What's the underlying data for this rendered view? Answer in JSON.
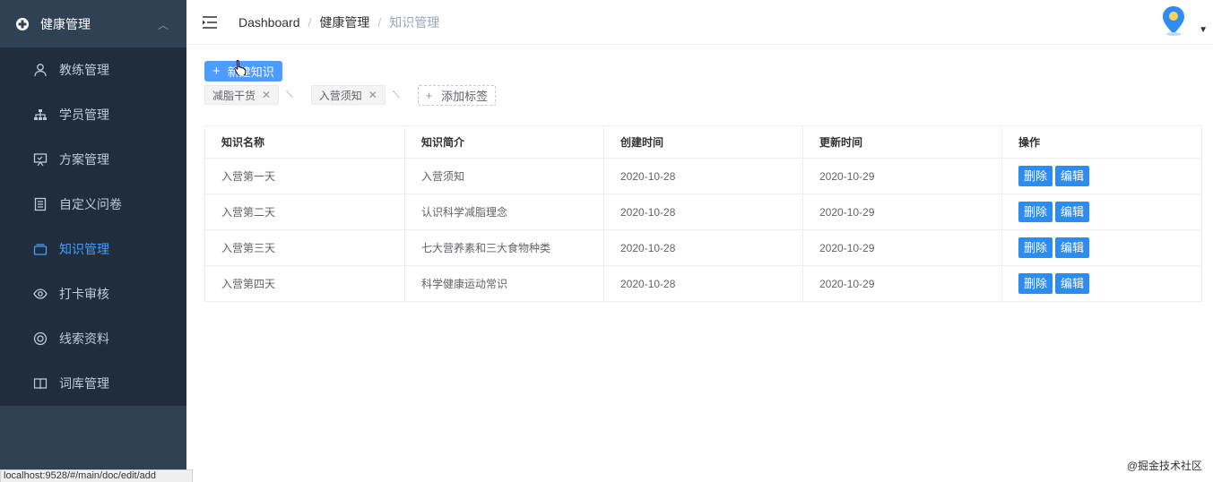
{
  "sidebar": {
    "parent_label": "健康管理",
    "items": [
      {
        "label": "教练管理",
        "icon": "user-icon"
      },
      {
        "label": "学员管理",
        "icon": "tree-icon"
      },
      {
        "label": "方案管理",
        "icon": "board-icon"
      },
      {
        "label": "自定义问卷",
        "icon": "form-icon"
      },
      {
        "label": "知识管理",
        "icon": "tray-icon",
        "active": true
      },
      {
        "label": "打卡审核",
        "icon": "eye-icon"
      },
      {
        "label": "线索资料",
        "icon": "lifebuoy-icon"
      },
      {
        "label": "词库管理",
        "icon": "book-icon"
      }
    ]
  },
  "breadcrumb": [
    "Dashboard",
    "健康管理",
    "知识管理"
  ],
  "toolbar": {
    "new_label": "新建知识"
  },
  "tags": [
    "减脂干货",
    "入营须知"
  ],
  "add_tag_label": "添加标签",
  "table": {
    "headers": [
      "知识名称",
      "知识简介",
      "创建时间",
      "更新时间",
      "操作"
    ],
    "rows": [
      [
        "入营第一天",
        "入营须知",
        "2020-10-28",
        "2020-10-29"
      ],
      [
        "入营第二天",
        "认识科学减脂理念",
        "2020-10-28",
        "2020-10-29"
      ],
      [
        "入营第三天",
        "七大营养素和三大食物种类",
        "2020-10-28",
        "2020-10-29"
      ],
      [
        "入营第四天",
        "科学健康运动常识",
        "2020-10-28",
        "2020-10-29"
      ]
    ],
    "delete_label": "删除",
    "edit_label": "编辑"
  },
  "statusbar_url": "localhost:9528/#/main/doc/edit/add",
  "watermark": "@掘金技术社区",
  "colors": {
    "sidebar_bg": "#304156",
    "submenu_bg": "#1f2d3d",
    "accent": "#409eff",
    "button": "#2d8cf0"
  }
}
